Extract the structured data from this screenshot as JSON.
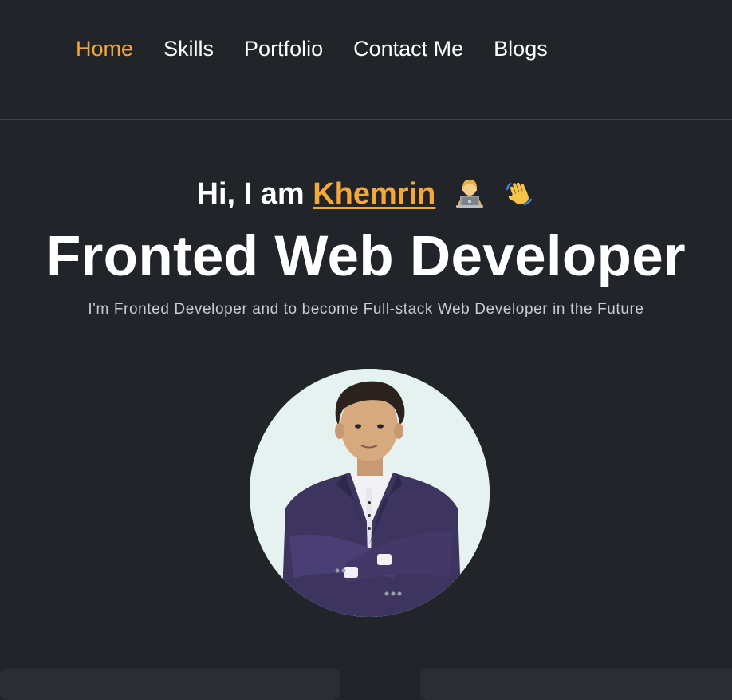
{
  "nav": {
    "items": [
      {
        "label": "Home",
        "active": true
      },
      {
        "label": "Skills",
        "active": false
      },
      {
        "label": "Portfolio",
        "active": false
      },
      {
        "label": "Contact Me",
        "active": false
      },
      {
        "label": "Blogs",
        "active": false
      }
    ]
  },
  "hero": {
    "greeting_prefix": "Hi, I am",
    "name": "Khemrin",
    "greeting_icons": [
      "technologist-icon",
      "waving-hand-icon"
    ],
    "headline": "Fronted Web Developer",
    "subtitle": "I'm Fronted Developer and to become Full-stack Web Developer in the Future"
  },
  "colors": {
    "background": "#212429",
    "accent": "#f4a73b",
    "text": "#ffffff",
    "muted_text": "#c9ccd1"
  }
}
